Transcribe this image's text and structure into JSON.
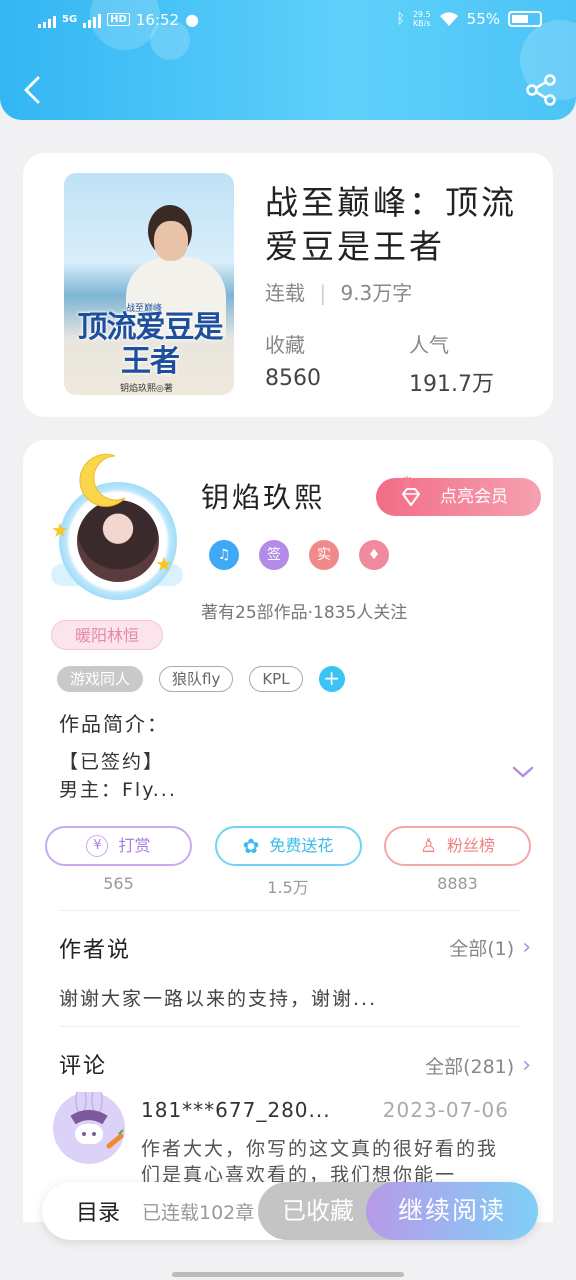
{
  "status_bar": {
    "network": "5G",
    "hd": "HD",
    "time": "16:52",
    "speed": "29.5",
    "speed_unit": "KB/s",
    "battery": "55%"
  },
  "book": {
    "title": "战至巅峰：顶流爱豆是王者",
    "status": "连载",
    "word_count": "9.3万字",
    "favorites_label": "收藏",
    "favorites_value": "8560",
    "popularity_label": "人气",
    "popularity_value": "191.7万",
    "cover": {
      "title": "顶流爱豆是王者",
      "subtitle": "战至巅峰",
      "author": "钥焰玖熙◎著"
    }
  },
  "author": {
    "name": "钥焰玖熙",
    "badge_label": "暖阳林恒",
    "vip_button": "点亮会员",
    "badges": [
      "♫",
      "签",
      "实",
      "♦"
    ],
    "works_info": "著有25部作品·1835人关注"
  },
  "tags": [
    "游戏同人",
    "狼队fly",
    "KPL"
  ],
  "intro": {
    "label": "作品简介：",
    "text": "【已签约】\n男主：Fly..."
  },
  "actions": [
    {
      "label": "打赏",
      "count": "565",
      "color": "#b48be6"
    },
    {
      "label": "免费送花",
      "count": "1.5万",
      "color": "#4cc4f7"
    },
    {
      "label": "粉丝榜",
      "count": "8883",
      "color": "#f08a8a"
    }
  ],
  "author_say": {
    "title": "作者说",
    "more": "全部(1)",
    "text": "谢谢大家一路以来的支持，谢谢..."
  },
  "comments": {
    "title": "评论",
    "more": "全部(281)",
    "user": "181***677_280...",
    "date": "2023-07-06",
    "text": "作者大大，你写的这文真的很好看的我们是真心喜欢看的，我们想你能一"
  },
  "bottom_bar": {
    "catalog": "目录",
    "catalog_sub": "已连载102章",
    "collected": "已收藏",
    "continue": "继续阅读"
  }
}
